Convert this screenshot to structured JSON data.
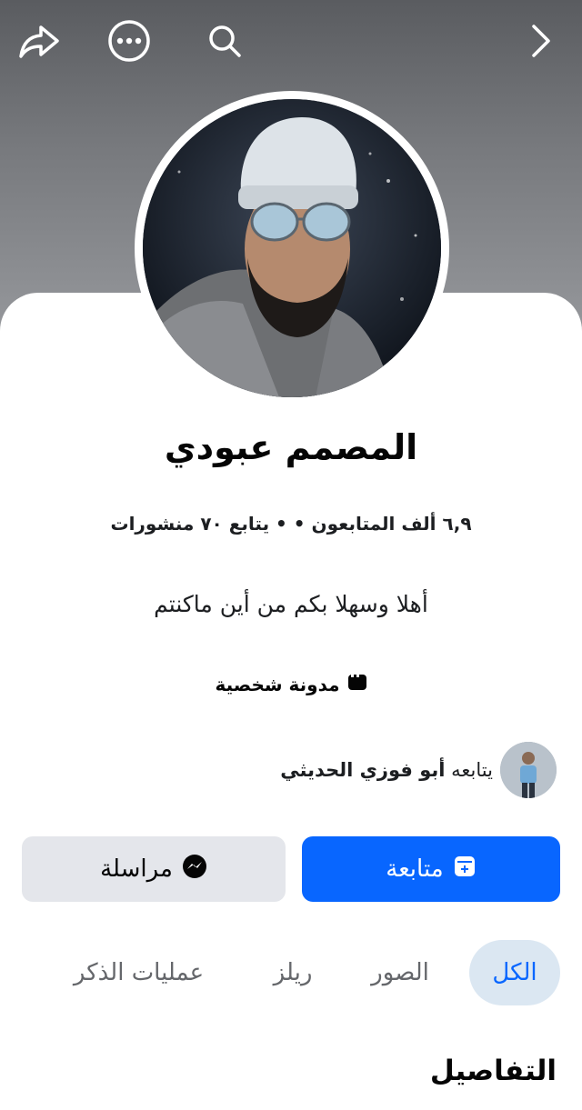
{
  "profile": {
    "name": "المصمم عبودي",
    "stats": "٦,٩ ألف المتابعون • • يتابع ٧٠ منشورات",
    "bio": "أهلا وسهلا بكم من أين ماكنتم",
    "category": "مدونة شخصية"
  },
  "followed_by": {
    "prefix": "يتابعه",
    "name": "أبو فوزي الحديثي"
  },
  "actions": {
    "follow_label": "متابعة",
    "message_label": "مراسلة"
  },
  "tabs": [
    {
      "label": "الكل",
      "active": true
    },
    {
      "label": "الصور",
      "active": false
    },
    {
      "label": "ريلز",
      "active": false
    },
    {
      "label": "عمليات الذكر",
      "active": false
    }
  ],
  "section": {
    "details_title": "التفاصيل"
  },
  "icons": {
    "top_left": [
      "share-icon",
      "more-icon",
      "search-icon"
    ],
    "top_right": [
      "chevron-right-icon"
    ]
  },
  "colors": {
    "accent": "#0866ff",
    "secondary_button": "#e4e6eb",
    "active_tab_bg": "#dbe7f2"
  }
}
